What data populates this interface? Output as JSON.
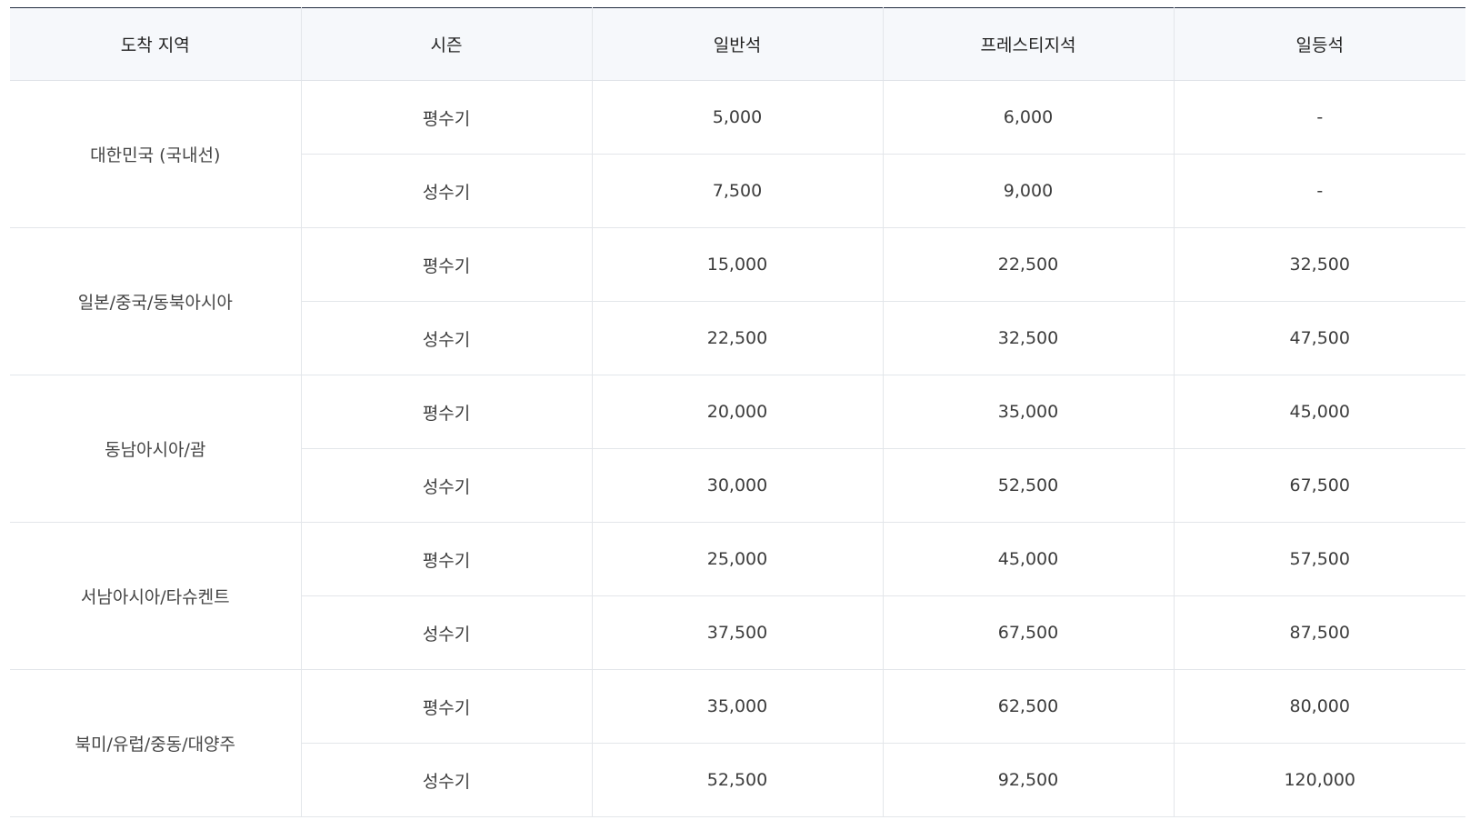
{
  "headers": {
    "region": "도착 지역",
    "season": "시즌",
    "economy": "일반석",
    "prestige": "프레스티지석",
    "first": "일등석"
  },
  "rows": [
    {
      "region": "대한민국 (국내선)",
      "seasons": [
        {
          "season": "평수기",
          "economy": "5,000",
          "prestige": "6,000",
          "first": "-"
        },
        {
          "season": "성수기",
          "economy": "7,500",
          "prestige": "9,000",
          "first": "-"
        }
      ]
    },
    {
      "region": "일본/중국/동북아시아",
      "seasons": [
        {
          "season": "평수기",
          "economy": "15,000",
          "prestige": "22,500",
          "first": "32,500"
        },
        {
          "season": "성수기",
          "economy": "22,500",
          "prestige": "32,500",
          "first": "47,500"
        }
      ]
    },
    {
      "region": "동남아시아/괌",
      "seasons": [
        {
          "season": "평수기",
          "economy": "20,000",
          "prestige": "35,000",
          "first": "45,000"
        },
        {
          "season": "성수기",
          "economy": "30,000",
          "prestige": "52,500",
          "first": "67,500"
        }
      ]
    },
    {
      "region": "서남아시아/타슈켄트",
      "seasons": [
        {
          "season": "평수기",
          "economy": "25,000",
          "prestige": "45,000",
          "first": "57,500"
        },
        {
          "season": "성수기",
          "economy": "37,500",
          "prestige": "67,500",
          "first": "87,500"
        }
      ]
    },
    {
      "region": "북미/유럽/중동/대양주",
      "seasons": [
        {
          "season": "평수기",
          "economy": "35,000",
          "prestige": "62,500",
          "first": "80,000"
        },
        {
          "season": "성수기",
          "economy": "52,500",
          "prestige": "92,500",
          "first": "120,000"
        }
      ]
    }
  ]
}
